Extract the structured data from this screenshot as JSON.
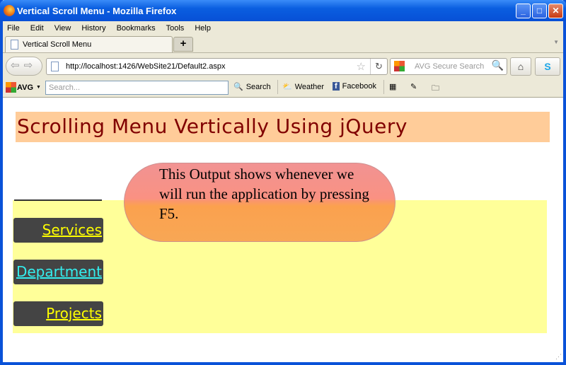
{
  "window": {
    "title": "Vertical Scroll Menu - Mozilla Firefox"
  },
  "menu": [
    "File",
    "Edit",
    "View",
    "History",
    "Bookmarks",
    "Tools",
    "Help"
  ],
  "tab": {
    "label": "Vertical Scroll Menu",
    "new_tab": "+"
  },
  "nav": {
    "url": "http://localhost:1426/WebSite21/Default2.aspx",
    "search_placeholder": "AVG Secure Search"
  },
  "avg": {
    "brand": "AVG",
    "search_placeholder": "Search...",
    "search_label": "Search",
    "weather": "Weather",
    "facebook": "Facebook"
  },
  "page": {
    "heading": "Scrolling Menu Vertically Using jQuery",
    "menu_items": [
      "Services",
      "Department",
      "Projects"
    ],
    "callout": "This Output shows whenever we will run the application by pressing F5."
  }
}
